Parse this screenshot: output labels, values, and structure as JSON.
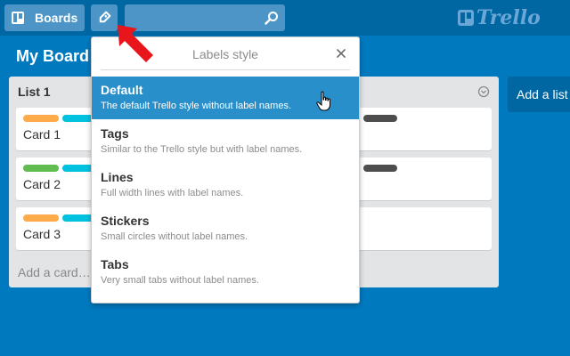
{
  "header": {
    "boards_label": "Boards",
    "search": {
      "value": "",
      "placeholder": ""
    },
    "logo_text": "Trello"
  },
  "board": {
    "title": "My Board",
    "list": {
      "title": "List 1",
      "cards": [
        {
          "text": "Card 1",
          "labels": [
            "#ffab4a",
            "#00c2e0"
          ]
        },
        {
          "text": "Card 2",
          "labels": [
            "#61bd4f",
            "#00c2e0"
          ]
        },
        {
          "text": "Card 3",
          "labels": [
            "#ffab4a",
            "#00c2e0"
          ]
        }
      ],
      "add_card": "Add a card…"
    },
    "add_list": "Add a list"
  },
  "popover": {
    "title": "Labels style",
    "options": [
      {
        "name": "Default",
        "desc": "The default Trello style without label names.",
        "selected": true
      },
      {
        "name": "Tags",
        "desc": "Similar to the Trello style but with label names."
      },
      {
        "name": "Lines",
        "desc": "Full width lines with label names."
      },
      {
        "name": "Stickers",
        "desc": "Small circles without label names."
      },
      {
        "name": "Tabs",
        "desc": "Very small tabs without label names."
      }
    ]
  },
  "colors": {
    "board_bg": "#0079bf",
    "header_bg": "#0067a3",
    "selected_option_bg": "#298fca",
    "annotation_arrow": "#e8151b",
    "card_dark_label": "#4d4d4d"
  }
}
